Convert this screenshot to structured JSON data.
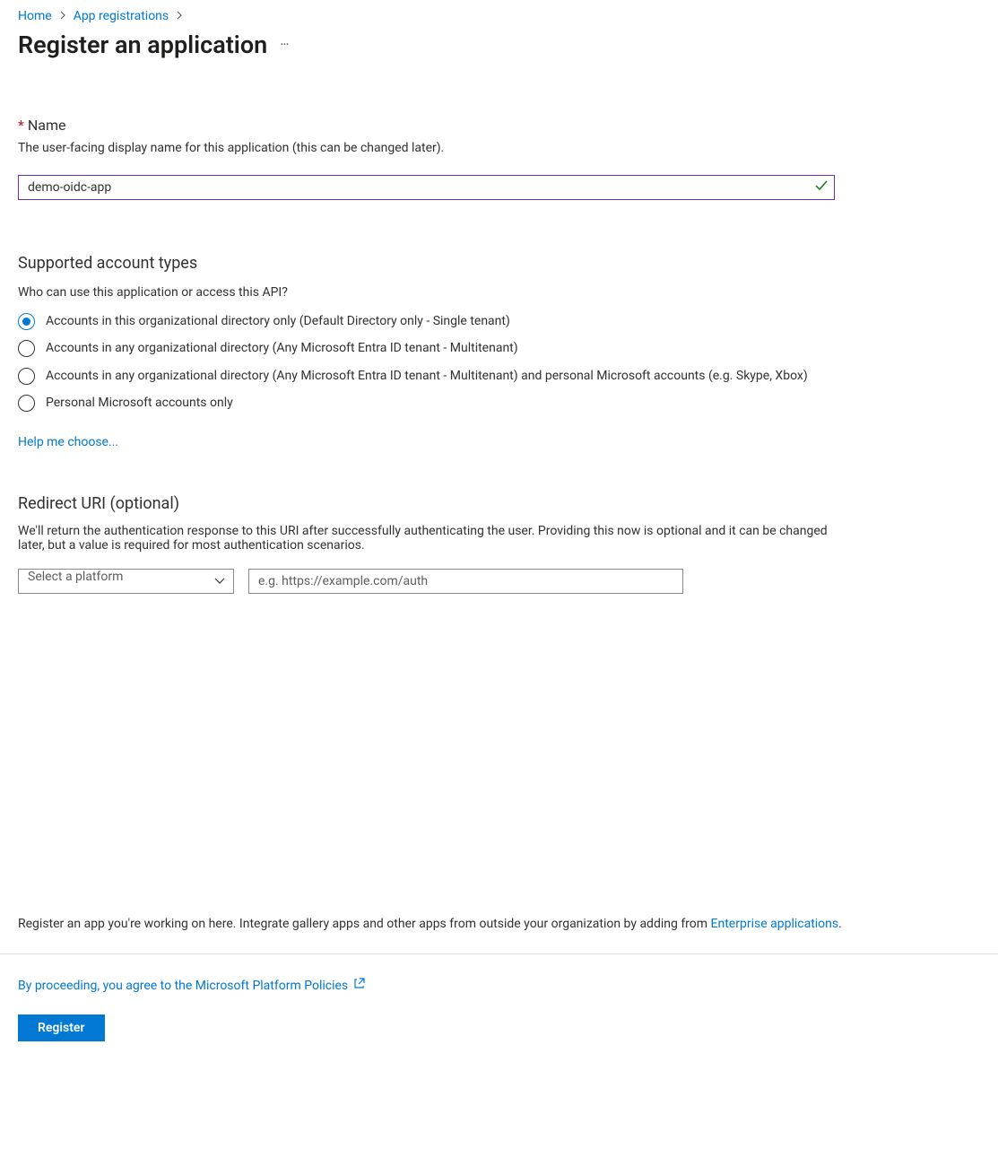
{
  "breadcrumb": {
    "home": "Home",
    "app_registrations": "App registrations"
  },
  "title": "Register an application",
  "name_section": {
    "label": "Name",
    "description": "The user-facing display name for this application (this can be changed later).",
    "value": "demo-oidc-app"
  },
  "account_types": {
    "title": "Supported account types",
    "question": "Who can use this application or access this API?",
    "options": [
      "Accounts in this organizational directory only (Default Directory only - Single tenant)",
      "Accounts in any organizational directory (Any Microsoft Entra ID tenant - Multitenant)",
      "Accounts in any organizational directory (Any Microsoft Entra ID tenant - Multitenant) and personal Microsoft accounts (e.g. Skype, Xbox)",
      "Personal Microsoft accounts only"
    ],
    "help_link": "Help me choose..."
  },
  "redirect": {
    "title": "Redirect URI (optional)",
    "description": "We'll return the authentication response to this URI after successfully authenticating the user. Providing this now is optional and it can be changed later, but a value is required for most authentication scenarios.",
    "platform_placeholder": "Select a platform",
    "uri_placeholder": "e.g. https://example.com/auth"
  },
  "bottom_note": {
    "text_before": "Register an app you're working on here. Integrate gallery apps and other apps from outside your organization by adding from ",
    "link_text": "Enterprise applications",
    "text_after": "."
  },
  "footer": {
    "policy_text": "By proceeding, you agree to the Microsoft Platform Policies",
    "register_label": "Register"
  }
}
